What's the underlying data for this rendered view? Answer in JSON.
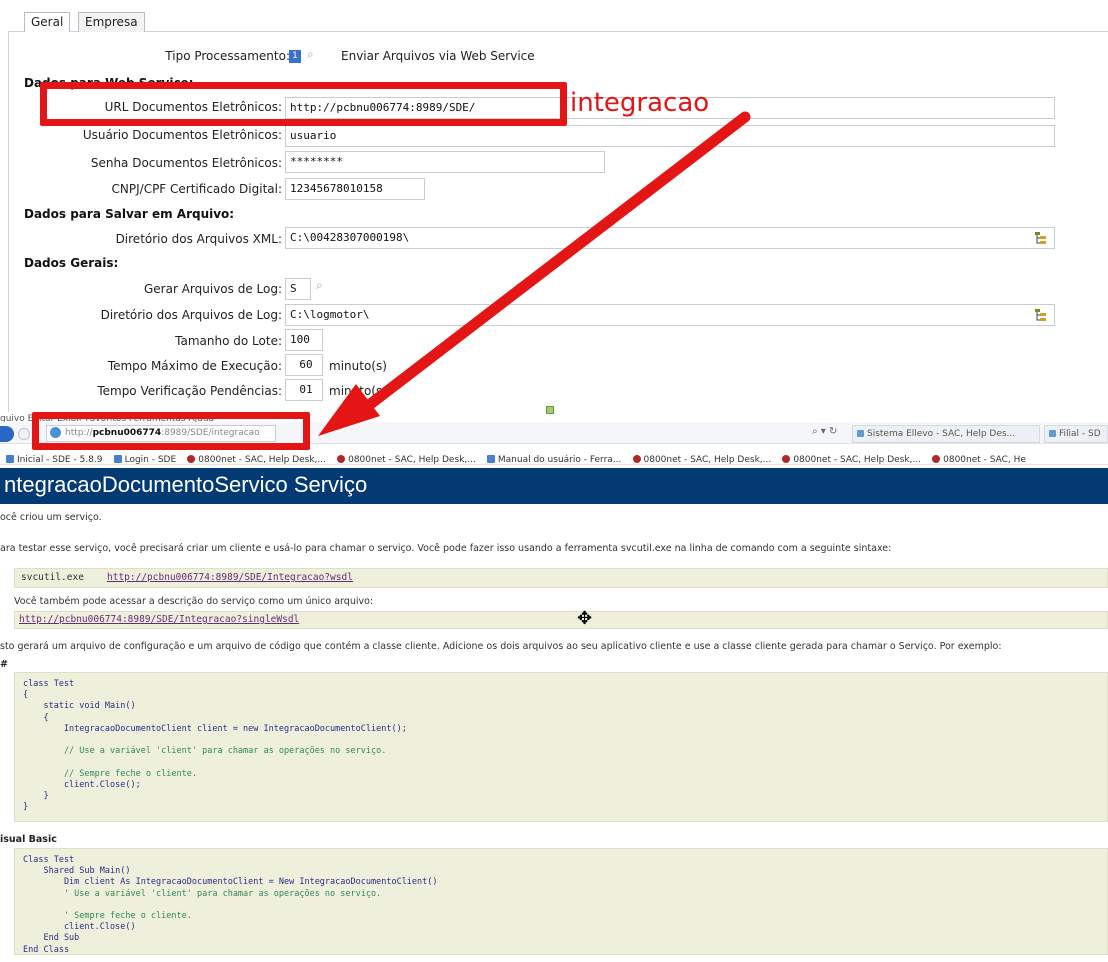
{
  "app": {
    "tabs": [
      "Geral",
      "Empresa"
    ],
    "fields": {
      "tipo_label": "Tipo Processamento:",
      "tipo_value": "1",
      "tipo_desc": "Enviar Arquivos via Web Service",
      "sec_ws": "Dados para Web Service:",
      "url_label": "URL Documentos Eletrônicos:",
      "url_value": "http://pcbnu006774:8989/SDE/",
      "user_label": "Usuário Documentos Eletrônicos:",
      "user_value": "usuario",
      "pass_label": "Senha Documentos Eletrônicos:",
      "pass_value": "********",
      "cnpj_label": "CNPJ/CPF Certificado Digital:",
      "cnpj_value": "12345678010158",
      "sec_file": "Dados para Salvar em Arquivo:",
      "xml_dir_label": "Diretório dos Arquivos XML:",
      "xml_dir_value": "C:\\00428307000198\\",
      "sec_general": "Dados Gerais:",
      "gen_log_label": "Gerar Arquivos de Log:",
      "gen_log_value": "S",
      "log_dir_label": "Diretório dos Arquivos de Log:",
      "log_dir_value": "C:\\logmotor\\",
      "lote_label": "Tamanho do Lote:",
      "lote_value": "100",
      "tempo_label": "Tempo Máximo de Execução:",
      "tempo_value": "60",
      "tempo_unit": "minuto(s)",
      "verif_label": "Tempo Verificação Pendências:",
      "verif_value": "01",
      "verif_unit": "minuto(s"
    }
  },
  "annotation": {
    "text": "integracao",
    "color": "#e31515"
  },
  "browser": {
    "menu_ghost": "quivo   Editar   Exibir   Favoritos   Ferramentas   Ajuda",
    "address_prefix": "http://",
    "address_host": "pcbnu006774",
    "address_rest": ":8989/SDE/integracao",
    "search_ctrl": "⌕ ▾ ↻",
    "tabs": [
      "Sistema Ellevo - SAC, Help Des...",
      "Filial - SD"
    ],
    "favorites": [
      "Inicial - SDE - 5.8.9",
      "Login - SDE",
      "0800net - SAC, Help Desk,...",
      "0800net - SAC, Help Desk,...",
      "Manual do usuário - Ferra...",
      "0800net - SAC, Help Desk,...",
      "0800net - SAC, Help Desk,...",
      "0800net - SAC, He"
    ],
    "page_title": "ntegracaoDocumentoServico Serviço",
    "p1": "ocê criou um serviço.",
    "p2": "ara testar esse serviço, você precisará criar um cliente e usá-lo para chamar o serviço. Você pode fazer isso usando a ferramenta svcutil.exe na linha de comando com a seguinte sintaxe:",
    "svcutil_cmd": "svcutil.exe ",
    "svcutil_link": "http://pcbnu006774:8989/SDE/Integracao?wsdl",
    "p3": "Você também pode acessar a descrição do serviço como um único arquivo:",
    "single_link": "http://pcbnu006774:8989/SDE/Integracao?singleWsdl",
    "p4": "sto gerará um arquivo de configuração e um arquivo de código que contém a classe cliente. Adicione os dois arquivos ao seu aplicativo cliente e use a classe cliente gerada para chamar o Serviço. Por exemplo:",
    "cs_heading": "#",
    "vb_heading": "isual Basic",
    "cs_code": [
      "class Test",
      "{",
      "    static void Main()",
      "    {",
      "        IntegracaoDocumentoClient client = new IntegracaoDocumentoClient();",
      "",
      "        // Use a variável 'client' para chamar as operações no serviço.",
      "",
      "        // Sempre feche o cliente.",
      "        client.Close();",
      "    }",
      "}"
    ],
    "vb_code": [
      "Class Test",
      "    Shared Sub Main()",
      "        Dim client As IntegracaoDocumentoClient = New IntegracaoDocumentoClient()",
      "        ' Use a variável 'client' para chamar as operações no serviço.",
      "",
      "        ' Sempre feche o cliente.",
      "        client.Close()",
      "    End Sub",
      "End Class"
    ]
  }
}
